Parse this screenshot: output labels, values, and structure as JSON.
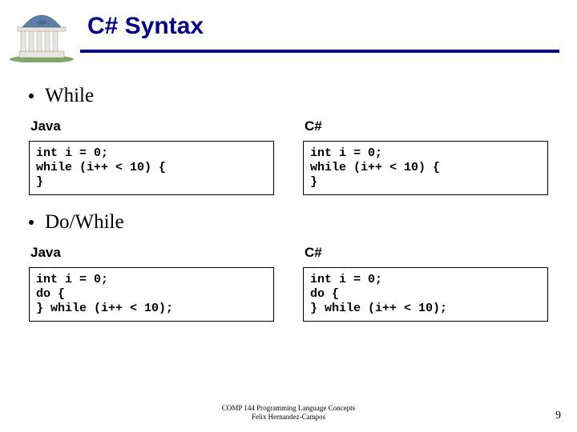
{
  "title": "C# Syntax",
  "sections": [
    {
      "heading": "While",
      "left_lang": "Java",
      "right_lang": "C#",
      "left_code": "int i = 0;\nwhile (i++ < 10) {\n}",
      "right_code": "int i = 0;\nwhile (i++ < 10) {\n}"
    },
    {
      "heading": "Do/While",
      "left_lang": "Java",
      "right_lang": "C#",
      "left_code": "int i = 0;\ndo {\n} while (i++ < 10);",
      "right_code": "int i = 0;\ndo {\n} while (i++ < 10);"
    }
  ],
  "footer_line1": "COMP 144 Programming Language Concepts",
  "footer_line2": "Felix Hernandez-Campos",
  "page_number": "9"
}
